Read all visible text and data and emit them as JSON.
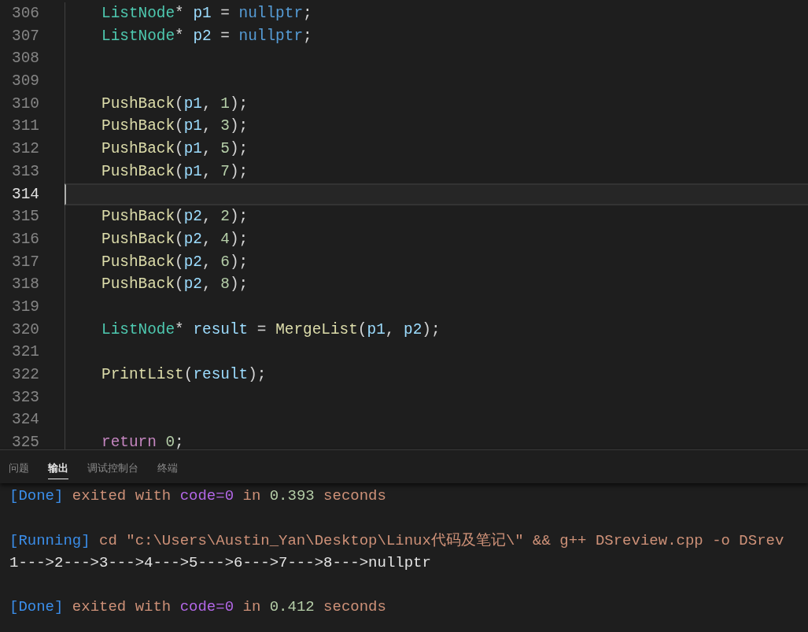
{
  "editor": {
    "lines": [
      {
        "number": "306",
        "current": false,
        "tokens": [
          {
            "kind": "type",
            "text": "ListNode"
          },
          {
            "kind": "punct",
            "text": "* "
          },
          {
            "kind": "var",
            "text": "p1"
          },
          {
            "kind": "punct",
            "text": " = "
          },
          {
            "kind": "constant",
            "text": "nullptr"
          },
          {
            "kind": "punct",
            "text": ";"
          }
        ]
      },
      {
        "number": "307",
        "current": false,
        "tokens": [
          {
            "kind": "type",
            "text": "ListNode"
          },
          {
            "kind": "punct",
            "text": "* "
          },
          {
            "kind": "var",
            "text": "p2"
          },
          {
            "kind": "punct",
            "text": " = "
          },
          {
            "kind": "constant",
            "text": "nullptr"
          },
          {
            "kind": "punct",
            "text": ";"
          }
        ]
      },
      {
        "number": "308",
        "current": false
      },
      {
        "number": "309",
        "current": false
      },
      {
        "number": "310",
        "current": false,
        "tokens": [
          {
            "kind": "function",
            "text": "PushBack"
          },
          {
            "kind": "punct",
            "text": "("
          },
          {
            "kind": "var",
            "text": "p1"
          },
          {
            "kind": "punct",
            "text": ", "
          },
          {
            "kind": "number",
            "text": "1"
          },
          {
            "kind": "punct",
            "text": ");"
          }
        ]
      },
      {
        "number": "311",
        "current": false,
        "tokens": [
          {
            "kind": "function",
            "text": "PushBack"
          },
          {
            "kind": "punct",
            "text": "("
          },
          {
            "kind": "var",
            "text": "p1"
          },
          {
            "kind": "punct",
            "text": ", "
          },
          {
            "kind": "number",
            "text": "3"
          },
          {
            "kind": "punct",
            "text": ");"
          }
        ]
      },
      {
        "number": "312",
        "current": false,
        "tokens": [
          {
            "kind": "function",
            "text": "PushBack"
          },
          {
            "kind": "punct",
            "text": "("
          },
          {
            "kind": "var",
            "text": "p1"
          },
          {
            "kind": "punct",
            "text": ", "
          },
          {
            "kind": "number",
            "text": "5"
          },
          {
            "kind": "punct",
            "text": ");"
          }
        ]
      },
      {
        "number": "313",
        "current": false,
        "tokens": [
          {
            "kind": "function",
            "text": "PushBack"
          },
          {
            "kind": "punct",
            "text": "("
          },
          {
            "kind": "var",
            "text": "p1"
          },
          {
            "kind": "punct",
            "text": ", "
          },
          {
            "kind": "number",
            "text": "7"
          },
          {
            "kind": "punct",
            "text": ");"
          }
        ]
      },
      {
        "number": "314",
        "current": true
      },
      {
        "number": "315",
        "current": false,
        "tokens": [
          {
            "kind": "function",
            "text": "PushBack"
          },
          {
            "kind": "punct",
            "text": "("
          },
          {
            "kind": "var",
            "text": "p2"
          },
          {
            "kind": "punct",
            "text": ", "
          },
          {
            "kind": "number",
            "text": "2"
          },
          {
            "kind": "punct",
            "text": ");"
          }
        ]
      },
      {
        "number": "316",
        "current": false,
        "tokens": [
          {
            "kind": "function",
            "text": "PushBack"
          },
          {
            "kind": "punct",
            "text": "("
          },
          {
            "kind": "var",
            "text": "p2"
          },
          {
            "kind": "punct",
            "text": ", "
          },
          {
            "kind": "number",
            "text": "4"
          },
          {
            "kind": "punct",
            "text": ");"
          }
        ]
      },
      {
        "number": "317",
        "current": false,
        "tokens": [
          {
            "kind": "function",
            "text": "PushBack"
          },
          {
            "kind": "punct",
            "text": "("
          },
          {
            "kind": "var",
            "text": "p2"
          },
          {
            "kind": "punct",
            "text": ", "
          },
          {
            "kind": "number",
            "text": "6"
          },
          {
            "kind": "punct",
            "text": ");"
          }
        ]
      },
      {
        "number": "318",
        "current": false,
        "tokens": [
          {
            "kind": "function",
            "text": "PushBack"
          },
          {
            "kind": "punct",
            "text": "("
          },
          {
            "kind": "var",
            "text": "p2"
          },
          {
            "kind": "punct",
            "text": ", "
          },
          {
            "kind": "number",
            "text": "8"
          },
          {
            "kind": "punct",
            "text": ");"
          }
        ]
      },
      {
        "number": "319",
        "current": false
      },
      {
        "number": "320",
        "current": false,
        "tokens": [
          {
            "kind": "type",
            "text": "ListNode"
          },
          {
            "kind": "punct",
            "text": "* "
          },
          {
            "kind": "var",
            "text": "result"
          },
          {
            "kind": "punct",
            "text": " = "
          },
          {
            "kind": "function",
            "text": "MergeList"
          },
          {
            "kind": "punct",
            "text": "("
          },
          {
            "kind": "var",
            "text": "p1"
          },
          {
            "kind": "punct",
            "text": ", "
          },
          {
            "kind": "var",
            "text": "p2"
          },
          {
            "kind": "punct",
            "text": ");"
          }
        ]
      },
      {
        "number": "321",
        "current": false
      },
      {
        "number": "322",
        "current": false,
        "tokens": [
          {
            "kind": "function",
            "text": "PrintList"
          },
          {
            "kind": "punct",
            "text": "("
          },
          {
            "kind": "var",
            "text": "result"
          },
          {
            "kind": "punct",
            "text": ");"
          }
        ]
      },
      {
        "number": "323",
        "current": false
      },
      {
        "number": "324",
        "current": false
      },
      {
        "number": "325",
        "current": false,
        "tokens": [
          {
            "kind": "keyword",
            "text": "return"
          },
          {
            "kind": "number",
            "text": "0",
            "spaced": true
          },
          {
            "kind": "punct",
            "text": ";"
          }
        ]
      }
    ]
  },
  "panel": {
    "tabs": [
      {
        "label": "问题",
        "selected": false
      },
      {
        "label": "输出",
        "selected": true
      },
      {
        "label": "调试控制台",
        "selected": false
      },
      {
        "label": "终端",
        "selected": false
      }
    ],
    "output": [
      {
        "lines": [
          {
            "segments": [
              {
                "kind": "tag",
                "text": "[Done]"
              },
              {
                "kind": "text",
                "text": " exited with "
              },
              {
                "kind": "code",
                "text": "code=0"
              },
              {
                "kind": "text",
                "text": " in "
              },
              {
                "kind": "number",
                "text": "0.393"
              },
              {
                "kind": "text",
                "text": " seconds"
              }
            ]
          }
        ]
      },
      {
        "lines": [
          {
            "segments": [
              {
                "kind": "tag",
                "text": "[Running]"
              },
              {
                "kind": "text",
                "text": " cd \"c:\\Users\\Austin_Yan\\Desktop\\Linux代码及笔记\\\" && g++ DSreview.cpp -o DSrev"
              }
            ]
          },
          {
            "segments": [
              {
                "kind": "plain",
                "text": "1--->2--->3--->4--->5--->6--->7--->8--->nullptr"
              }
            ]
          }
        ]
      },
      {
        "lines": [
          {
            "segments": [
              {
                "kind": "tag",
                "text": "[Done]"
              },
              {
                "kind": "text",
                "text": " exited with "
              },
              {
                "kind": "code",
                "text": "code=0"
              },
              {
                "kind": "text",
                "text": " in "
              },
              {
                "kind": "number",
                "text": "0.412"
              },
              {
                "kind": "text",
                "text": " seconds"
              }
            ]
          }
        ]
      }
    ]
  }
}
